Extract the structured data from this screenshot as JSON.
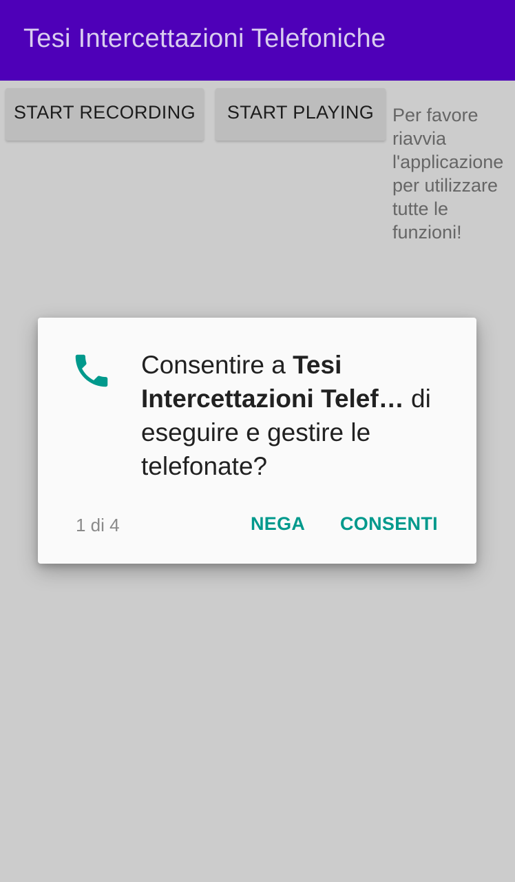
{
  "app_bar": {
    "title": "Tesi Intercettazioni Telefoniche",
    "color": "#4e00b8"
  },
  "buttons": {
    "start_recording": "START RECORDING",
    "start_playing": "START PLAYING"
  },
  "hint_text": "Per favore riavvia l'applicazione per utilizzare tutte le funzioni!",
  "permission_dialog": {
    "icon": "phone-icon",
    "message_prefix": "Consentire a ",
    "app_name": "Tesi Intercettazioni Telef…",
    "message_suffix": " di eseguire e gestire le telefonate?",
    "counter": "1 di 4",
    "deny_label": "NEGA",
    "allow_label": "CONSENTI",
    "accent_color": "#00998c"
  }
}
